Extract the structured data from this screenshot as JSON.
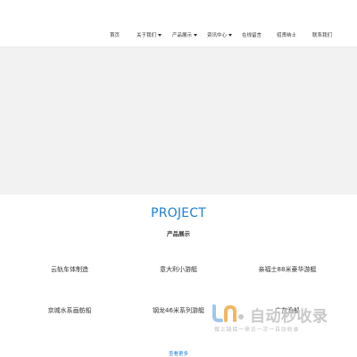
{
  "nav": {
    "items": [
      {
        "label": "首页",
        "has_dropdown": false
      },
      {
        "label": "关于我们",
        "has_dropdown": true
      },
      {
        "label": "产品展示",
        "has_dropdown": true
      },
      {
        "label": "资讯中心",
        "has_dropdown": true
      },
      {
        "label": "在线留言",
        "has_dropdown": false
      },
      {
        "label": "招贤纳士",
        "has_dropdown": false
      },
      {
        "label": "联系我们",
        "has_dropdown": false
      }
    ]
  },
  "section": {
    "title": "PROJECT",
    "subtitle": "产品展示",
    "more_label": "查看更多"
  },
  "products": [
    {
      "label": "云轨车体制造"
    },
    {
      "label": "意大利小游艇"
    },
    {
      "label": "亲福士88米豪华游艇"
    },
    {
      "label": "京城水系画舫船"
    },
    {
      "label": "钢龙46米系列游艇"
    },
    {
      "label": "广东渔船"
    }
  ],
  "watermark": {
    "title": "自动秒收录",
    "subtitle": "做上链接一来访一次一自动收录"
  },
  "colors": {
    "accent": "#1e80d6",
    "banner": "#f2f2f2"
  }
}
